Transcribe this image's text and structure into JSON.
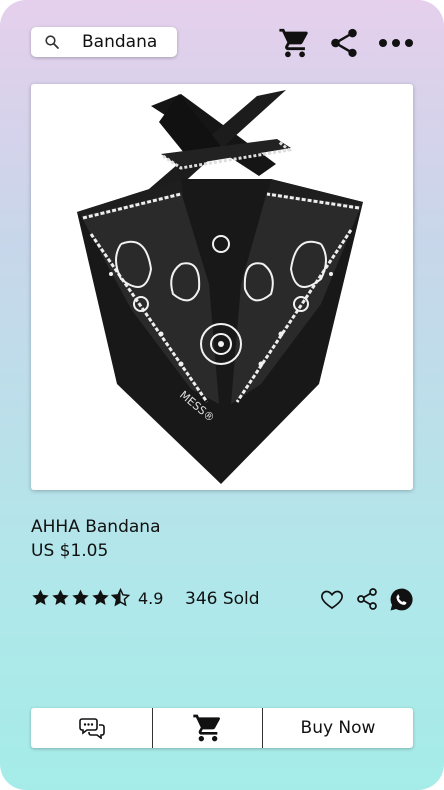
{
  "search": {
    "query": "Bandana",
    "icon": "search-icon"
  },
  "header": {
    "icons": [
      "cart-icon",
      "share-icon",
      "more-icon"
    ]
  },
  "product": {
    "image_alt": "black paisley bandana",
    "name": "AHHA Bandana",
    "price": "US $1.05",
    "rating": "4.9",
    "rating_stars": 4.5,
    "sold": "346 Sold"
  },
  "actions": {
    "icons": [
      "heart-icon",
      "share-icon",
      "whatsapp-icon"
    ]
  },
  "bottom_bar": {
    "chat_icon": "chat-icon",
    "cart_icon": "cart-icon",
    "buy_label": "Buy Now"
  }
}
